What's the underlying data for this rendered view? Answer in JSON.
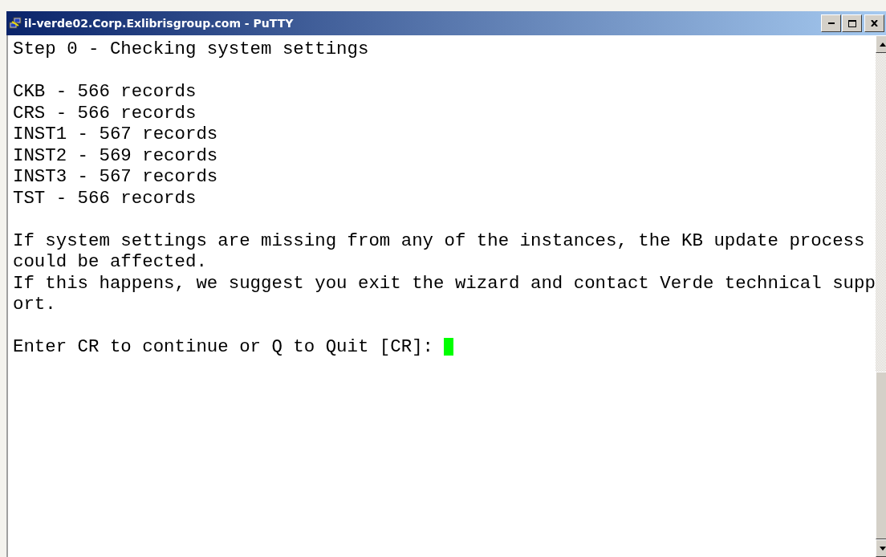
{
  "window": {
    "title": "il-verde02.Corp.Exlibrisgroup.com - PuTTY"
  },
  "terminal": {
    "paragraphs": [
      [
        "Step 0 - Checking system settings"
      ],
      [
        "CKB - 566 records",
        "CRS - 566 records",
        "INST1 - 567 records",
        "INST2 - 569 records",
        "INST3 - 567 records",
        "TST - 566 records"
      ],
      [
        "If system settings are missing from any of the instances, the KB update process",
        "could be affected.",
        "If this happens, we suggest you exit the wizard and contact Verde technical supp",
        "ort."
      ]
    ],
    "prompt": "Enter CR to continue or Q to Quit [CR]: "
  }
}
